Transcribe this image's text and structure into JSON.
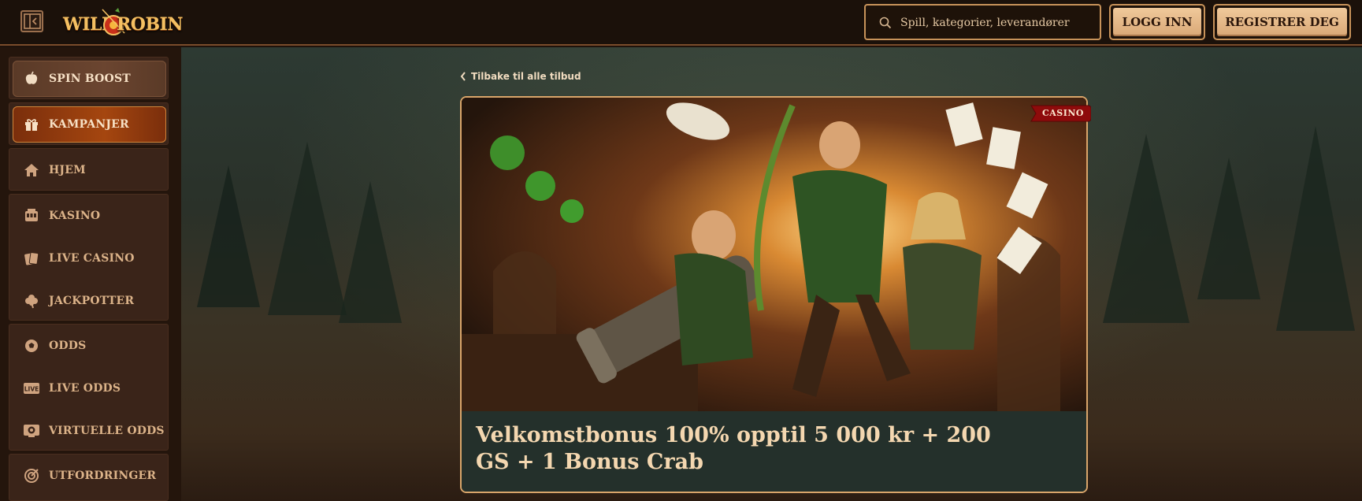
{
  "header": {
    "logo_left": "WILD",
    "logo_right": "ROBIN",
    "search_placeholder": "Spill, kategorier, leverandører",
    "login_label": "LOGG INN",
    "register_label": "REGISTRER DEG"
  },
  "sidebar": {
    "items": [
      {
        "label": "SPIN BOOST",
        "icon": "apple-icon"
      },
      {
        "label": "KAMPANJER",
        "icon": "gift-icon"
      },
      {
        "label": "HJEM",
        "icon": "home-icon"
      },
      {
        "label": "KASINO",
        "icon": "slot-machine-icon"
      },
      {
        "label": "LIVE CASINO",
        "icon": "cards-icon"
      },
      {
        "label": "JACKPOTTER",
        "icon": "clover-icon"
      },
      {
        "label": "ODDS",
        "icon": "ball-icon"
      },
      {
        "label": "LIVE ODDS",
        "icon": "live-icon"
      },
      {
        "label": "VIRTUELLE ODDS",
        "icon": "virtual-ball-icon"
      },
      {
        "label": "UTFORDRINGER",
        "icon": "target-icon"
      }
    ]
  },
  "main": {
    "back_label": "Tilbake til alle tilbud",
    "badge": "CASINO",
    "offer_title": "Velkomstbonus 100% opptil 5 000 kr + 200 GS + 1 Bonus Crab"
  },
  "colors": {
    "accent_gold": "#d9a56a",
    "button_fill": "#e8bb8a",
    "kampanjer_highlight": "#a5460f",
    "badge_red": "#8e0b0b"
  }
}
